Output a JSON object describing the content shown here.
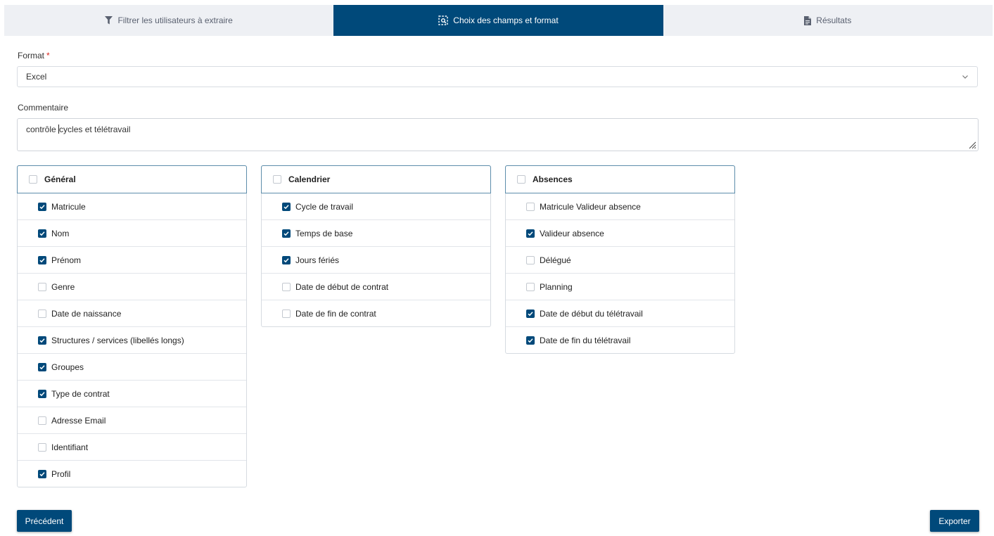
{
  "tabs": [
    {
      "label": "Filtrer les utilisateurs à extraire",
      "icon": "filter-icon",
      "active": false
    },
    {
      "label": "Choix des champs et format",
      "icon": "selection-search-icon",
      "active": true
    },
    {
      "label": "Résultats",
      "icon": "document-icon",
      "active": false
    }
  ],
  "format": {
    "label": "Format",
    "required_mark": "*",
    "value": "Excel"
  },
  "comment": {
    "label": "Commentaire",
    "value_before_caret": "contrôle ",
    "value_after_caret": "cycles et télétravail"
  },
  "panels": [
    {
      "title": "Général",
      "checked": false,
      "items": [
        {
          "label": "Matricule",
          "checked": true
        },
        {
          "label": "Nom",
          "checked": true
        },
        {
          "label": "Prénom",
          "checked": true
        },
        {
          "label": "Genre",
          "checked": false
        },
        {
          "label": "Date de naissance",
          "checked": false
        },
        {
          "label": "Structures / services (libellés longs)",
          "checked": true
        },
        {
          "label": "Groupes",
          "checked": true
        },
        {
          "label": "Type de contrat",
          "checked": true
        },
        {
          "label": "Adresse Email",
          "checked": false
        },
        {
          "label": "Identifiant",
          "checked": false
        },
        {
          "label": "Profil",
          "checked": true
        }
      ]
    },
    {
      "title": "Calendrier",
      "checked": false,
      "items": [
        {
          "label": "Cycle de travail",
          "checked": true
        },
        {
          "label": "Temps de base",
          "checked": true
        },
        {
          "label": "Jours fériés",
          "checked": true
        },
        {
          "label": "Date de début de contrat",
          "checked": false
        },
        {
          "label": "Date de fin de contrat",
          "checked": false
        }
      ]
    },
    {
      "title": "Absences",
      "checked": false,
      "items": [
        {
          "label": "Matricule Valideur absence",
          "checked": false
        },
        {
          "label": "Valideur absence",
          "checked": true
        },
        {
          "label": "Délégué",
          "checked": false
        },
        {
          "label": "Planning",
          "checked": false
        },
        {
          "label": "Date de début du télétravail",
          "checked": true
        },
        {
          "label": "Date de fin du télétravail",
          "checked": true
        }
      ]
    }
  ],
  "buttons": {
    "previous": "Précédent",
    "export": "Exporter"
  },
  "colors": {
    "primary": "#00497a",
    "tab_bg": "#eef0f4",
    "required": "#d9251d"
  }
}
